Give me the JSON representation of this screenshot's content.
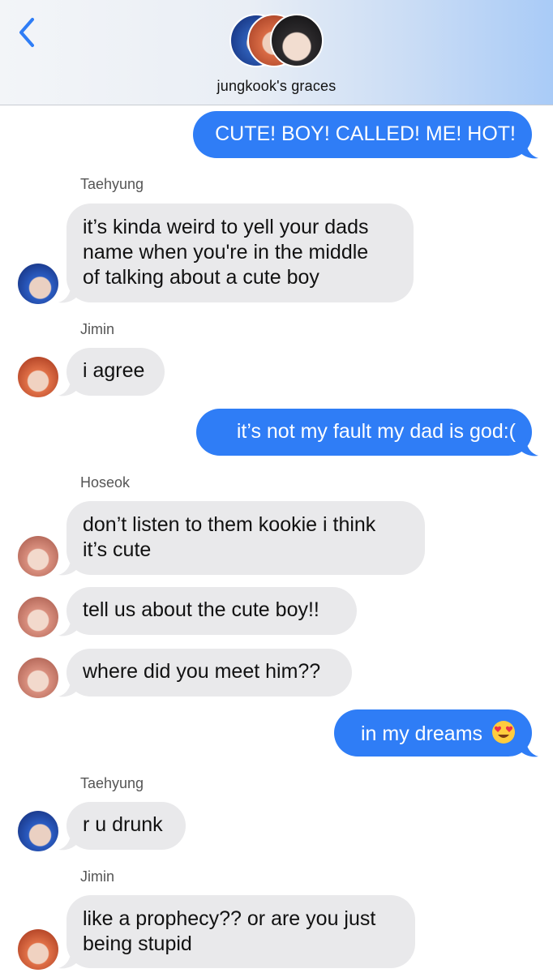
{
  "header": {
    "back_icon": "chevron-left-icon",
    "title": "jungkook's graces",
    "accent_color": "#2f7df6"
  },
  "messages": [
    {
      "type": "sent",
      "lines": [
        "CUTE! BOY! CALLED! ME! HOT!"
      ]
    },
    {
      "type": "received",
      "sender": "Taehyung",
      "lines": [
        "it’s kinda weird to yell your dads",
        "name when you're in the middle",
        "of talking about a cute boy"
      ]
    },
    {
      "type": "received",
      "sender": "Jimin",
      "lines": [
        "i agree"
      ]
    },
    {
      "type": "sent",
      "lines": [
        "it’s not my fault my dad is god:("
      ]
    },
    {
      "type": "received",
      "sender": "Hoseok",
      "lines": [
        "don’t listen to them kookie i think",
        "it’s cute"
      ]
    },
    {
      "type": "received",
      "lines": [
        "tell us about the cute boy!!"
      ]
    },
    {
      "type": "received",
      "lines": [
        "where did you meet him??"
      ]
    },
    {
      "type": "sent",
      "lines": [
        "in my dreams"
      ],
      "emoji": "heart-eyes-emoji"
    },
    {
      "type": "received",
      "sender": "Taehyung",
      "lines": [
        "r u drunk"
      ]
    },
    {
      "type": "received",
      "sender": "Jimin",
      "lines": [
        "like a prophecy?? or are you just",
        "being stupid"
      ]
    }
  ]
}
